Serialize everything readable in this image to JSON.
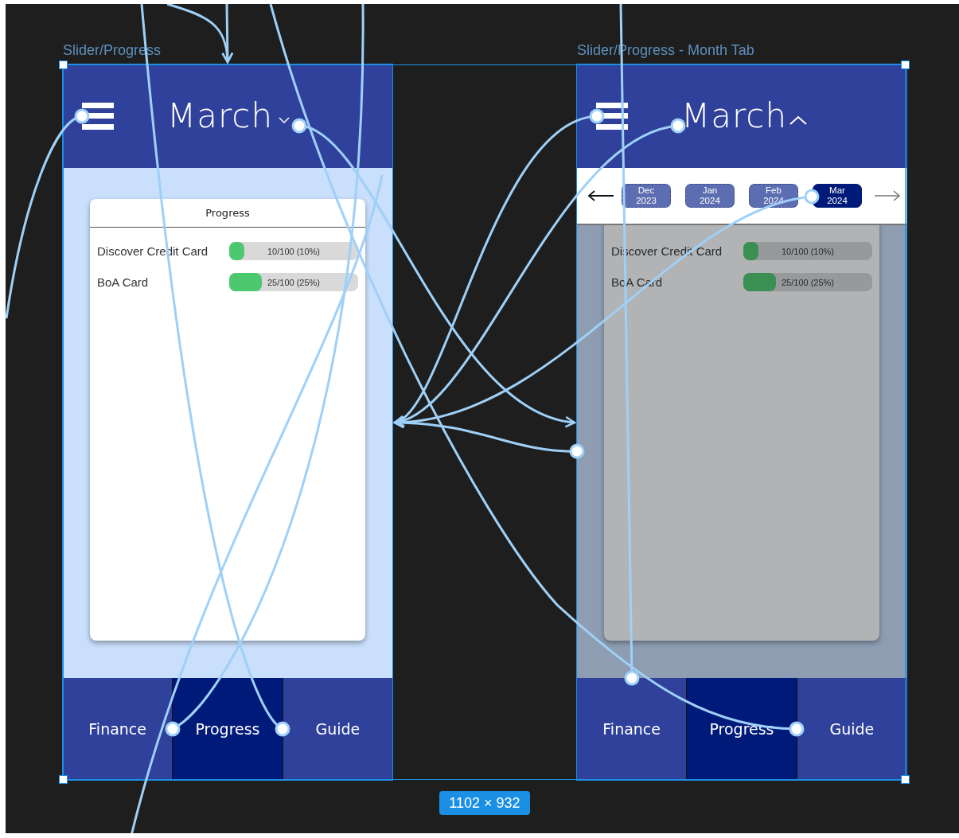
{
  "frames": [
    {
      "label": "Slider/Progress",
      "title": "March",
      "expanded": false,
      "dimmed": false,
      "card": {
        "title": "Progress",
        "rows": [
          {
            "name": "Discover Credit Card",
            "level": 0.1,
            "reading": "10/100 (10%)"
          },
          {
            "name": "BoA Card",
            "level": 0.25,
            "reading": "25/100 (25%)"
          }
        ]
      },
      "nav": [
        {
          "label": "Finance",
          "selected": false
        },
        {
          "label": "Progress",
          "selected": true
        },
        {
          "label": "Guide",
          "selected": false
        }
      ]
    },
    {
      "label": "Slider/Progress - Month Tab",
      "title": "March",
      "expanded": true,
      "dimmed": true,
      "month_picker": {
        "tabs": [
          {
            "month": "Dec",
            "year": "2023",
            "selected": false
          },
          {
            "month": "Jan",
            "year": "2024",
            "selected": false
          },
          {
            "month": "Feb",
            "year": "2024",
            "selected": false
          },
          {
            "month": "Mar",
            "year": "2024",
            "selected": true
          }
        ]
      },
      "card": {
        "rows": [
          {
            "name": "Discover Credit Card",
            "level": 0.1,
            "reading": "10/100 (10%)"
          },
          {
            "name": "BoA Card",
            "level": 0.25,
            "reading": "25/100 (25%)"
          }
        ]
      },
      "nav": [
        {
          "label": "Finance",
          "selected": false
        },
        {
          "label": "Progress",
          "selected": true
        },
        {
          "label": "Guide",
          "selected": false
        }
      ]
    }
  ],
  "size_badge": "1102 × 932"
}
